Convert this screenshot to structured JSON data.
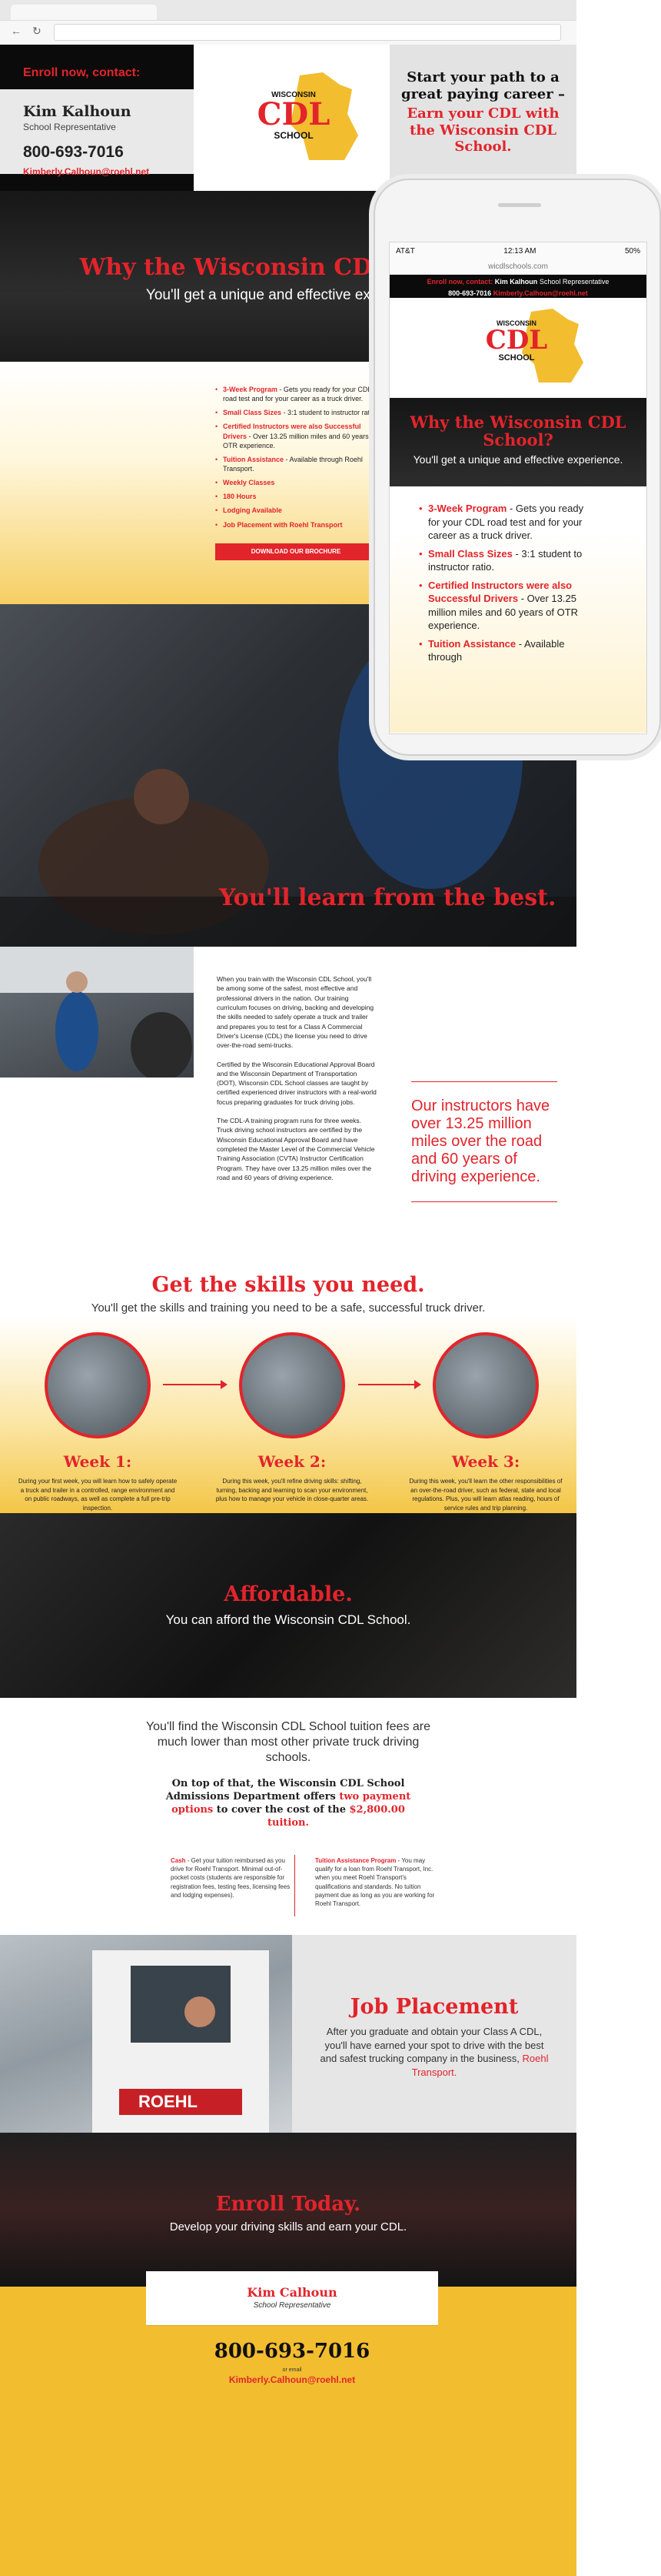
{
  "header": {
    "enroll_label": "Enroll now, contact:",
    "rep_name": "Kim Kalhoun",
    "rep_role": "School Representative",
    "phone": "800-693-7016",
    "email": "Kimberly.Calhoun@roehl.net",
    "logo": {
      "line1": "WISCONSIN",
      "line2": "CDL",
      "line3": "SCHOOL"
    },
    "tagline_black": "Start your path to a great paying career –",
    "tagline_red": "Earn your CDL with the Wisconsin CDL School."
  },
  "why": {
    "title": "Why the Wisconsin CDL School?",
    "subtitle": "You'll get a unique and effective experience."
  },
  "benefits": [
    {
      "strong": "3-Week Program",
      "text": " - Gets you ready for your CDL road test and for your career as a truck driver."
    },
    {
      "strong": "Small Class Sizes",
      "text": " - 3:1 student to instructor ratio."
    },
    {
      "strong": "Certified Instructors were also Successful Drivers",
      "text": " - Over 13.25 million miles and 60 years of OTR experience."
    },
    {
      "strong": "Tuition Assistance",
      "text": " - Available through Roehl Transport."
    },
    {
      "strong": "Weekly Classes",
      "text": ""
    },
    {
      "strong": "180 Hours",
      "text": ""
    },
    {
      "strong": "Lodging Available",
      "text": ""
    },
    {
      "strong": "Job Placement with Roehl Transport",
      "text": ""
    }
  ],
  "brochure_button": "DOWNLOAD OUR BROCHURE",
  "learn": {
    "title": "You'll learn from the best.",
    "p1": "When you train with the Wisconsin CDL School, you'll be among some of the safest, most effective and professional drivers in the nation. Our training curriculum focuses on driving, backing and developing the skills needed to safely operate a truck and trailer and prepares you to test for a Class A Commercial Driver's License (CDL) the license you need to drive over-the-road semi-trucks.",
    "p2": "Certified by the Wisconsin Educational Approval Board and the Wisconsin Department of Transportation (DOT), Wisconsin CDL School classes are taught by certified experienced driver instructors with a real-world focus preparing graduates for truck driving jobs.",
    "p3": "The CDL-A training program runs for three weeks. Truck driving school instructors are certified by the Wisconsin Educational Approval Board and have completed the Master Level of the Commercial Vehicle Training Association (CVTA) Instructor Certification Program. They have over 13.25 million miles over the road and 60 years of driving experience.",
    "quote": "Our instructors have over 13.25 million miles over the road and 60 years of driving experience."
  },
  "skills": {
    "title": "Get the skills you need.",
    "subtitle": "You'll get the skills and training you need to be a safe, successful truck driver.",
    "weeks": [
      {
        "title": "Week 1:",
        "text": "During your first week, you will learn how to safely operate a truck and trailer in a controlled, range environment and on public roadways, as well as complete a full pre-trip inspection."
      },
      {
        "title": "Week 2:",
        "text": "During this week, you'll refine driving skills: shifting, turning, backing and learning to scan your environment, plus how to manage your vehicle in close-quarter areas."
      },
      {
        "title": "Week 3:",
        "text": "During this week, you'll learn the other responsibilities of an over-the-road driver, such as federal, state and local regulations. Plus, you will learn atlas reading, hours of service rules and trip planning."
      }
    ]
  },
  "afford": {
    "title": "Affordable.",
    "subtitle": "You can afford the Wisconsin CDL School."
  },
  "tuition": {
    "p1": "You'll find the Wisconsin CDL School tuition fees are much lower than most other private truck driving schools.",
    "p2_a": "On top of that, the Wisconsin CDL School Admissions Department offers ",
    "p2_b": "two payment options",
    "p2_c": " to cover the cost of the ",
    "p2_d": "$2,800.00 tuition.",
    "cash_label": "Cash",
    "cash_text": " - Get your tuition reimbursed as you drive for Roehl Transport. Minimal out-of-pocket costs (students are responsible for registration fees, testing fees, licensing fees and lodging expenses).",
    "assist_label": "Tuition Assistance Program",
    "assist_text": " - You may qualify for a loan from Roehl Transport, Inc. when you meet Roehl Transport's qualifications and standards. No tuition payment due as long as you are working for Roehl Transport."
  },
  "job": {
    "title": "Job Placement",
    "text": "After you graduate and obtain your Class A CDL, you'll have earned your spot to drive with the best and safest trucking company in the business, ",
    "link": "Roehl Transport."
  },
  "enroll": {
    "title": "Enroll Today.",
    "subtitle": "Develop your driving skills and earn your CDL."
  },
  "contact": {
    "name": "Kim Calhoun",
    "role": "School Representative",
    "phone": "800-693-7016",
    "or": "or email",
    "email": "Kimberly.Calhoun@roehl.net"
  },
  "mobile": {
    "carrier": "AT&T",
    "time": "12:13 AM",
    "battery": "50%",
    "url": "wicdlschools.com",
    "enroll_label": "Enroll now, contact:",
    "rep_name": "Kim Kalhoun",
    "rep_role": "School Representative",
    "phone": "800-693-7016",
    "email": "Kimberly.Calhoun@roehl.net",
    "why_title": "Why the Wisconsin CDL School?",
    "why_subtitle": "You'll get a unique and effective experience.",
    "items": [
      {
        "strong": "3-Week Program",
        "text": " - Gets you ready for your CDL road test and for your career as a truck driver."
      },
      {
        "strong": "Small Class Sizes",
        "text": " - 3:1 student to instructor ratio."
      },
      {
        "strong": "Certified Instructors were also Successful Drivers",
        "text": " - Over 13.25 million miles and 60 years of OTR experience."
      },
      {
        "strong": "Tuition Assistance",
        "text": " - Available through"
      }
    ]
  },
  "colors": {
    "brand_red": "#e2242b",
    "brand_yellow": "#f2bd2f",
    "dark": "#0b0b0b"
  }
}
